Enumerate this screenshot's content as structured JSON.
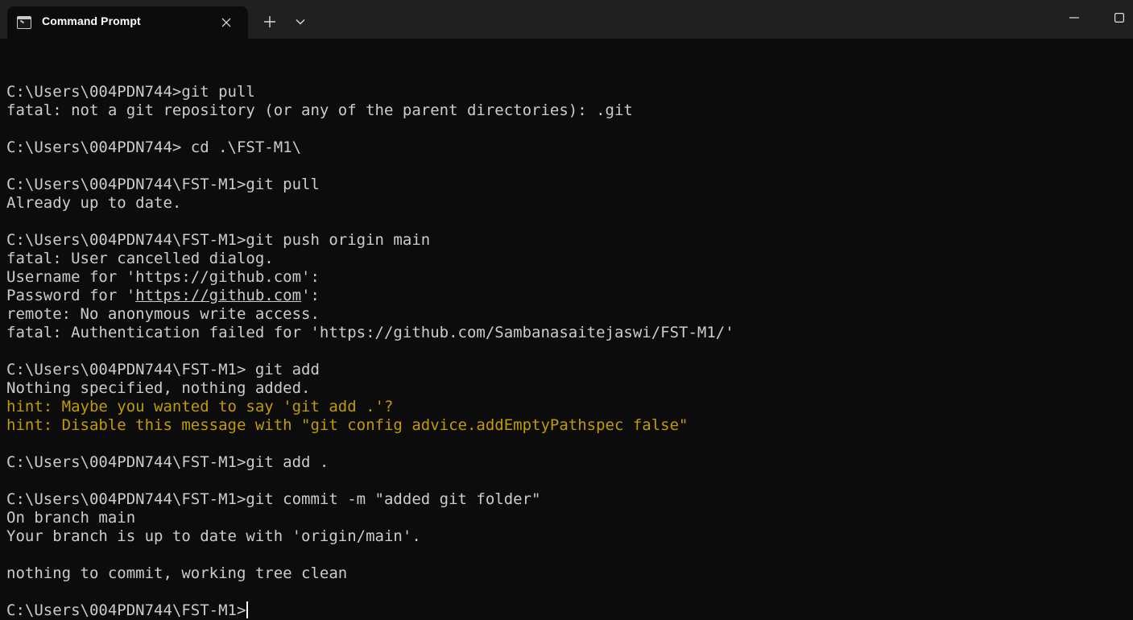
{
  "window": {
    "tab_title": "Command Prompt"
  },
  "icons": {
    "tab_icon": "terminal-icon",
    "close": "close-icon",
    "new_tab": "plus-icon",
    "dropdown": "chevron-down-icon",
    "minimize": "minimize-icon",
    "maximize": "maximize-icon"
  },
  "colors": {
    "background": "#0c0c0c",
    "text": "#cccccc",
    "hint": "#c19c00",
    "titlebar": "#202020"
  },
  "terminal": {
    "lines": [
      {
        "text": ""
      },
      {
        "text": "C:\\Users\\004PDN744>git pull"
      },
      {
        "text": "fatal: not a git repository (or any of the parent directories): .git"
      },
      {
        "text": ""
      },
      {
        "text": "C:\\Users\\004PDN744> cd .\\FST-M1\\"
      },
      {
        "text": ""
      },
      {
        "text": "C:\\Users\\004PDN744\\FST-M1>git pull"
      },
      {
        "text": "Already up to date."
      },
      {
        "text": ""
      },
      {
        "text": "C:\\Users\\004PDN744\\FST-M1>git push origin main"
      },
      {
        "text": "fatal: User cancelled dialog."
      },
      {
        "text": "Username for 'https://github.com':"
      },
      {
        "text": "Password for '",
        "link": "https://github.com",
        "after": "':"
      },
      {
        "text": "remote: No anonymous write access."
      },
      {
        "text": "fatal: Authentication failed for 'https://github.com/Sambanasaitejaswi/FST-M1/'"
      },
      {
        "text": ""
      },
      {
        "text": "C:\\Users\\004PDN744\\FST-M1> git add"
      },
      {
        "text": "Nothing specified, nothing added."
      },
      {
        "text": "hint: Maybe you wanted to say 'git add .'?",
        "style": "hint"
      },
      {
        "text": "hint: Disable this message with \"git config advice.addEmptyPathspec false\"",
        "style": "hint"
      },
      {
        "text": ""
      },
      {
        "text": "C:\\Users\\004PDN744\\FST-M1>git add ."
      },
      {
        "text": ""
      },
      {
        "text": "C:\\Users\\004PDN744\\FST-M1>git commit -m \"added git folder\""
      },
      {
        "text": "On branch main"
      },
      {
        "text": "Your branch is up to date with 'origin/main'."
      },
      {
        "text": ""
      },
      {
        "text": "nothing to commit, working tree clean"
      },
      {
        "text": ""
      },
      {
        "text": "C:\\Users\\004PDN744\\FST-M1>",
        "cursor": true
      }
    ]
  }
}
